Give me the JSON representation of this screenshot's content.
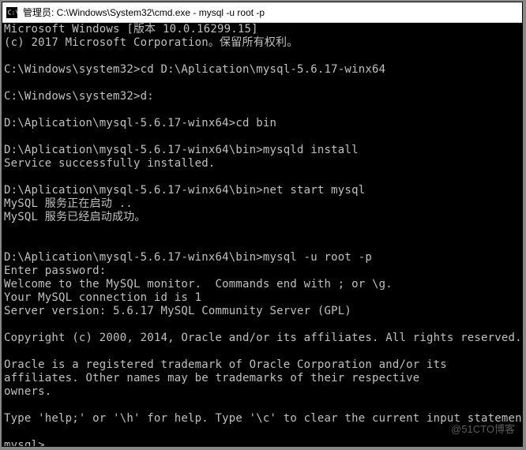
{
  "window": {
    "title": "管理员: C:\\Windows\\System32\\cmd.exe - mysql  -u root -p"
  },
  "terminal": {
    "lines": [
      "Microsoft Windows [版本 10.0.16299.15]",
      "(c) 2017 Microsoft Corporation。保留所有权利。",
      "",
      "C:\\Windows\\system32>cd D:\\Aplication\\mysql-5.6.17-winx64",
      "",
      "C:\\Windows\\system32>d:",
      "",
      "D:\\Aplication\\mysql-5.6.17-winx64>cd bin",
      "",
      "D:\\Aplication\\mysql-5.6.17-winx64\\bin>mysqld install",
      "Service successfully installed.",
      "",
      "D:\\Aplication\\mysql-5.6.17-winx64\\bin>net start mysql",
      "MySQL 服务正在启动 ..",
      "MySQL 服务已经启动成功。",
      "",
      "",
      "D:\\Aplication\\mysql-5.6.17-winx64\\bin>mysql -u root -p",
      "Enter password:",
      "Welcome to the MySQL monitor.  Commands end with ; or \\g.",
      "Your MySQL connection id is 1",
      "Server version: 5.6.17 MySQL Community Server (GPL)",
      "",
      "Copyright (c) 2000, 2014, Oracle and/or its affiliates. All rights reserved.",
      "",
      "Oracle is a registered trademark of Oracle Corporation and/or its",
      "affiliates. Other names may be trademarks of their respective",
      "owners.",
      "",
      "Type 'help;' or '\\h' for help. Type '\\c' to clear the current input statement.",
      "",
      "mysql>"
    ]
  },
  "watermark": "@51CTO博客"
}
